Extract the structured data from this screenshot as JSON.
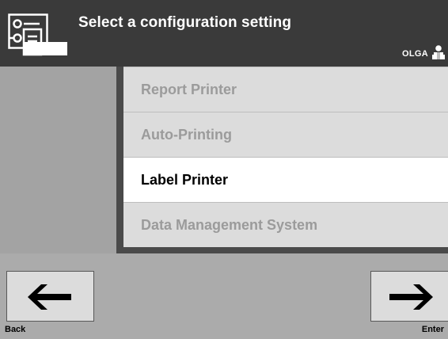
{
  "header": {
    "title": "Select a configuration setting",
    "operator": "OLGA"
  },
  "list": {
    "items": [
      {
        "label": "Report Printer",
        "selected": false
      },
      {
        "label": "Auto-Printing",
        "selected": false
      },
      {
        "label": "Label Printer",
        "selected": true
      },
      {
        "label": "Data Management System",
        "selected": false
      }
    ]
  },
  "nav": {
    "back_label": "Back",
    "enter_label": "Enter"
  },
  "icons": {
    "header": "configuration-settings-icon",
    "operator": "user-icon",
    "back": "arrow-left-icon",
    "enter": "arrow-right-icon"
  },
  "colors": {
    "header_bg": "#3a3a3a",
    "background": "#ababab",
    "item_bg": "#dcdcdc",
    "item_selected_bg": "#ffffff",
    "item_disabled_text": "#9b9b9b"
  }
}
